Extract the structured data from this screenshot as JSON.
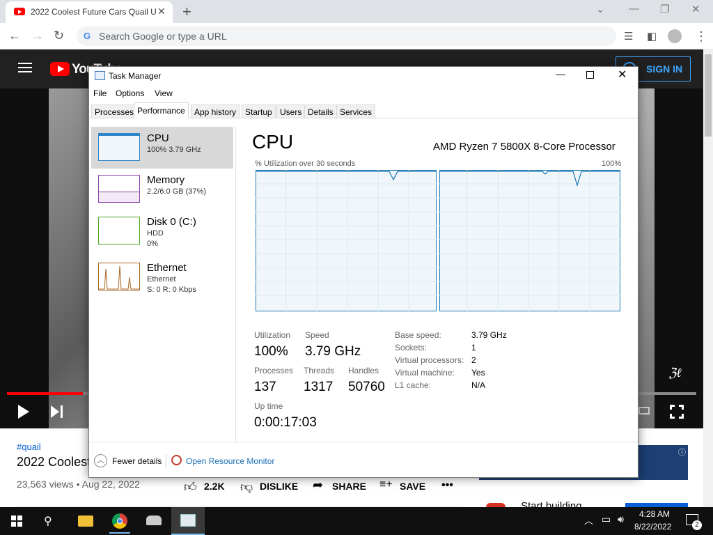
{
  "browser": {
    "tab_title": "2022 Coolest Future Cars Quail U",
    "omnibox_placeholder": "Search Google or type a URL"
  },
  "youtube": {
    "logo_text": "YouTube",
    "sign_in": "SIGN IN",
    "hashtag": "#quail",
    "video_title": "2022 Coolest",
    "meta": "23,563 views • Aug 22, 2022",
    "likes": "2.2K",
    "dislike": "DISLIKE",
    "share": "SHARE",
    "save": "SAVE",
    "ad_text": "Start building",
    "progress": 0.11
  },
  "task_manager": {
    "title": "Task Manager",
    "menu": [
      "File",
      "Options",
      "View"
    ],
    "tabs": [
      "Processes",
      "Performance",
      "App history",
      "Startup",
      "Users",
      "Details",
      "Services"
    ],
    "active_tab": "Performance",
    "side_items": [
      {
        "title": "CPU",
        "sub1": "100% 3.79 GHz",
        "sub2": ""
      },
      {
        "title": "Memory",
        "sub1": "2.2/6.0 GB (37%)",
        "sub2": ""
      },
      {
        "title": "Disk 0 (C:)",
        "sub1": "HDD",
        "sub2": "0%"
      },
      {
        "title": "Ethernet",
        "sub1": "Ethernet",
        "sub2": "S: 0 R: 0 Kbps"
      }
    ],
    "header": "CPU",
    "processor": "AMD Ryzen 7 5800X 8-Core Processor",
    "graph_label": "% Utilization over 30 seconds",
    "graph_max": "100%",
    "stats": {
      "utilization_label": "Utilization",
      "utilization": "100%",
      "speed_label": "Speed",
      "speed": "3.79 GHz",
      "processes_label": "Processes",
      "processes": "137",
      "threads_label": "Threads",
      "threads": "1317",
      "handles_label": "Handles",
      "handles": "50760",
      "uptime_label": "Up time",
      "uptime": "0:00:17:03"
    },
    "specs": [
      {
        "label": "Base speed:",
        "value": "3.79 GHz"
      },
      {
        "label": "Sockets:",
        "value": "1"
      },
      {
        "label": "Virtual processors:",
        "value": "2"
      },
      {
        "label": "Virtual machine:",
        "value": "Yes"
      },
      {
        "label": "L1 cache:",
        "value": "N/A"
      }
    ],
    "fewer_details": "Fewer details",
    "open_resource_monitor": "Open Resource Monitor"
  },
  "taskbar": {
    "time": "4:28 AM",
    "date": "8/22/2022",
    "notifications": "2"
  }
}
